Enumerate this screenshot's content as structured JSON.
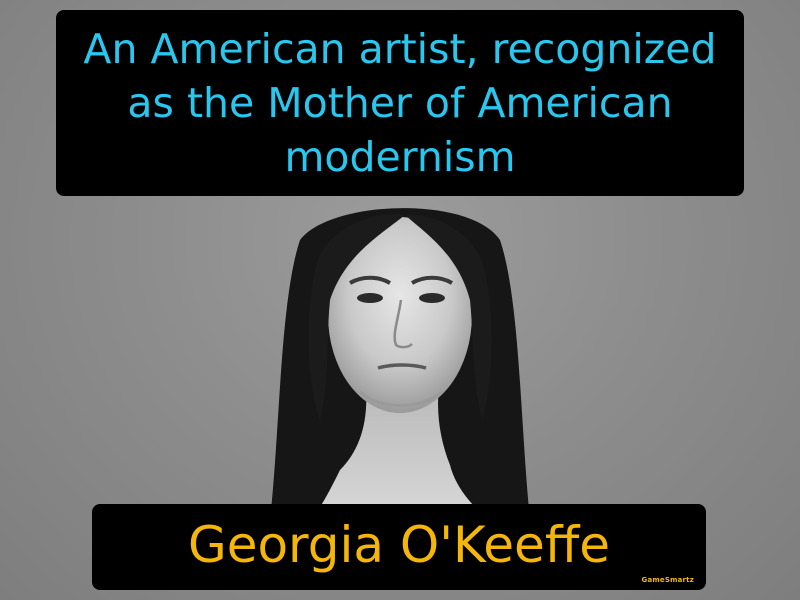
{
  "definition": "An American artist, recognized as the Mother of American modernism",
  "term": "Georgia O'Keeffe",
  "brand": "GameSmartz",
  "colors": {
    "background": "#8a8a8a",
    "box": "#000000",
    "definition_text": "#29c6ee",
    "term_text": "#f5b60a"
  }
}
